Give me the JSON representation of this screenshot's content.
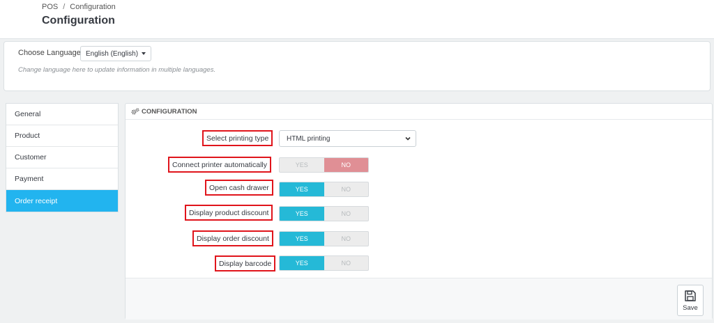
{
  "breadcrumb": {
    "root": "POS",
    "separator": "/",
    "current": "Configuration"
  },
  "page_title": "Configuration",
  "language": {
    "label": "Choose Language",
    "selected": "English (English)",
    "help": "Change language here to update information in multiple languages."
  },
  "tabs": [
    {
      "label": "General",
      "active": false
    },
    {
      "label": "Product",
      "active": false
    },
    {
      "label": "Customer",
      "active": false
    },
    {
      "label": "Payment",
      "active": false
    },
    {
      "label": "Order receipt",
      "active": true
    }
  ],
  "config": {
    "heading": "CONFIGURATION",
    "heading_icon": "cogs-icon",
    "printing_type": {
      "label": "Select printing type",
      "value": "HTML printing"
    },
    "switches": [
      {
        "label": "Connect printer automatically",
        "yes": "YES",
        "no": "NO",
        "value": "no"
      },
      {
        "label": "Open cash drawer",
        "yes": "YES",
        "no": "NO",
        "value": "yes"
      },
      {
        "label": "Display product discount",
        "yes": "YES",
        "no": "NO",
        "value": "yes"
      },
      {
        "label": "Display order discount",
        "yes": "YES",
        "no": "NO",
        "value": "yes"
      },
      {
        "label": "Display barcode",
        "yes": "YES",
        "no": "NO",
        "value": "yes"
      }
    ],
    "save_label": "Save",
    "save_icon": "floppy-disk-icon"
  },
  "colors": {
    "active_tab": "#22b4ef",
    "switch_yes": "#25b9d7",
    "switch_no": "#e08f95",
    "highlight_box": "#e0141b"
  }
}
